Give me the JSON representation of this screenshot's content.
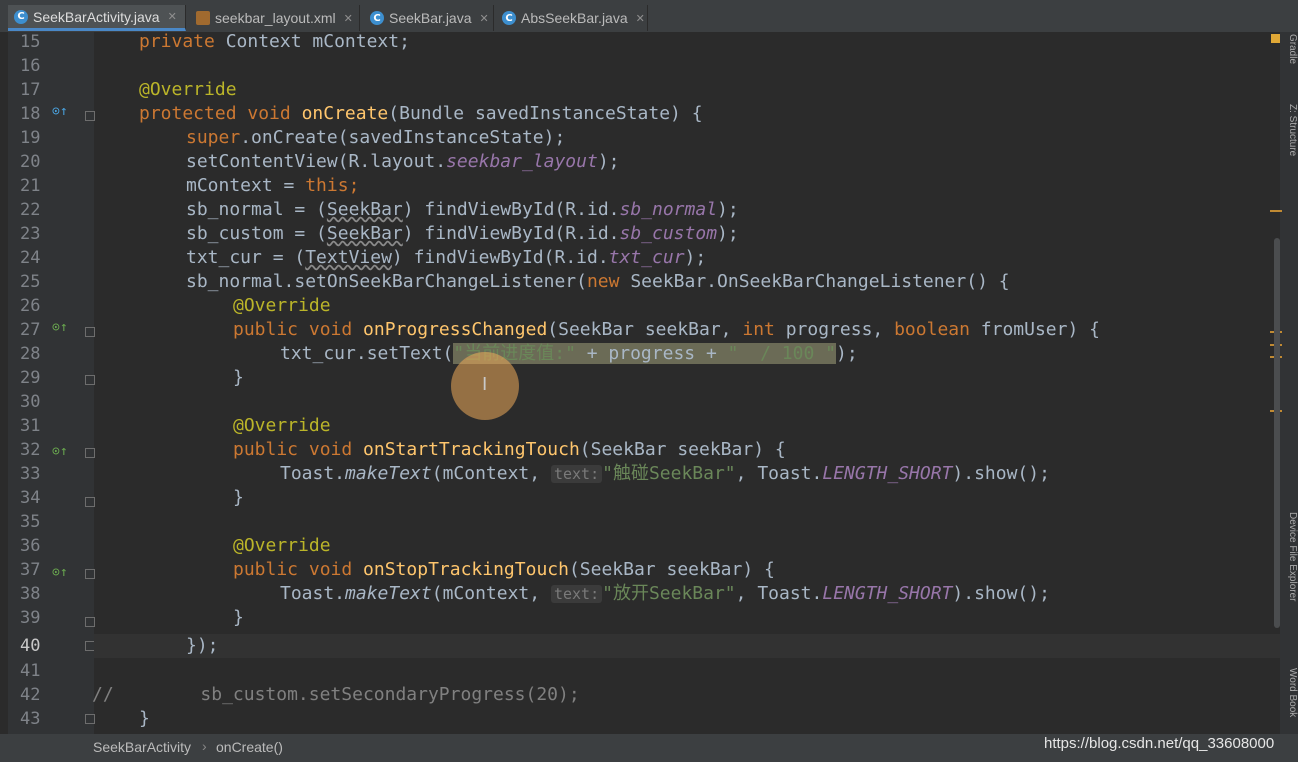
{
  "tabs": [
    {
      "label": "SeekBarActivity.java",
      "type": "C",
      "active": true
    },
    {
      "label": "seekbar_layout.xml",
      "type": "xml",
      "active": false
    },
    {
      "label": "SeekBar.java",
      "type": "C",
      "active": false
    },
    {
      "label": "AbsSeekBar.java",
      "type": "C",
      "active": false
    }
  ],
  "line_numbers": [
    "15",
    "16",
    "17",
    "18",
    "19",
    "20",
    "21",
    "22",
    "23",
    "24",
    "25",
    "26",
    "27",
    "28",
    "29",
    "30",
    "31",
    "32",
    "33",
    "34",
    "35",
    "36",
    "37",
    "38",
    "39",
    "40",
    "41",
    "42",
    "43"
  ],
  "code": {
    "l15_a": "private",
    "l15_b": " Context mContext;",
    "l17": "@Override",
    "l18_a": "protected void ",
    "l18_fn": "onCreate",
    "l18_b": "(Bundle savedInstanceState) {",
    "l19_a": "super",
    "l19_b": ".onCreate(savedInstanceState);",
    "l20_a": "setContentView(R.layout.",
    "l20_it": "seekbar_layout",
    "l20_b": ");",
    "l21_a": "mContext = ",
    "l21_kw": "this",
    "l21_b": ";",
    "l22_a": "sb_normal = (",
    "l22_w": "SeekBar",
    "l22_b": ") findViewById(R.id.",
    "l22_it": "sb_normal",
    "l22_c": ");",
    "l23_a": "sb_custom = (",
    "l23_w": "SeekBar",
    "l23_b": ") findViewById(R.id.",
    "l23_it": "sb_custom",
    "l23_c": ");",
    "l24_a": "txt_cur = (",
    "l24_w": "TextView",
    "l24_b": ") findViewById(R.id.",
    "l24_it": "txt_cur",
    "l24_c": ");",
    "l25_a": "sb_normal.setOnSeekBarChangeListener(",
    "l25_kw": "new",
    "l25_b": " SeekBar.OnSeekBarChangeListener() {",
    "l26": "@Override",
    "l27_a": "public void ",
    "l27_fn": "onProgressChanged",
    "l27_b": "(SeekBar seekBar, ",
    "l27_kw1": "int",
    "l27_c": " progress, ",
    "l27_kw2": "boolean",
    "l27_d": " fromUser) {",
    "l28_a": "txt_cur.setText(",
    "l28_s1": "\"当前进度值:\"",
    "l28_b": " + progress + ",
    "l28_s2": "\"  / 100 \"",
    "l28_c": ");",
    "close_brace": "}",
    "l31": "@Override",
    "l32_a": "public void ",
    "l32_fn": "onStartTrackingTouch",
    "l32_b": "(SeekBar seekBar) {",
    "l33_a": "Toast.",
    "l33_it": "makeText",
    "l33_b": "(mContext, ",
    "l33_hint": "text:",
    "l33_s": "\"触碰SeekBar\"",
    "l33_c": ", Toast.",
    "l33_it2": "LENGTH_SHORT",
    "l33_d": ").show();",
    "l36": "@Override",
    "l37_a": "public void ",
    "l37_fn": "onStopTrackingTouch",
    "l37_b": "(SeekBar seekBar) {",
    "l38_a": "Toast.",
    "l38_it": "makeText",
    "l38_b": "(mContext, ",
    "l38_hint": "text:",
    "l38_s": "\"放开SeekBar\"",
    "l38_c": ", Toast.",
    "l38_it2": "LENGTH_SHORT",
    "l38_d": ").show();",
    "l40": "});",
    "l42_cmt": "//",
    "l42_a": "sb_custom.setSecondaryProgress(",
    "l42_num": "20",
    "l42_b": ");",
    "l43": "}"
  },
  "side_panels": {
    "gradle": "Gradle",
    "structure": "Z: Structure",
    "device_explorer": "Device File Explorer",
    "word_book": "Word Book"
  },
  "status": {
    "crumb1": "SeekBarActivity",
    "sep": "›",
    "crumb2": "onCreate()",
    "watermark": "https://blog.csdn.net/qq_33608000"
  }
}
